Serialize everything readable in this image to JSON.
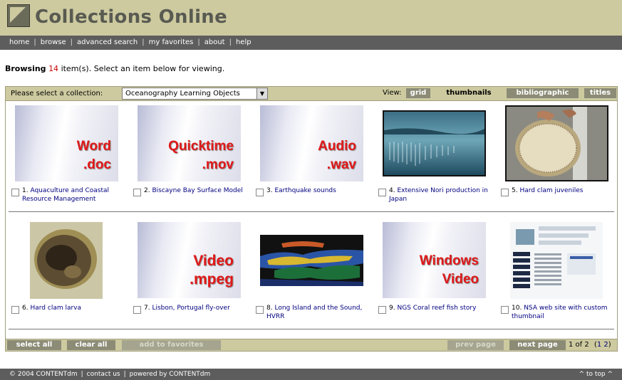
{
  "app": {
    "title": "Collections Online"
  },
  "nav": {
    "items": [
      "home",
      "browse",
      "advanced search",
      "my favorites",
      "about",
      "help"
    ]
  },
  "browse": {
    "prefix": "Browsing",
    "count": "14",
    "suffix": "item(s). Select an item below for viewing."
  },
  "toolbar": {
    "collection_label": "Please select a collection:",
    "collection_value": "Oceanography Learning Objects",
    "view_label": "View:",
    "views": [
      "grid",
      "thumbnails",
      "bibliographic",
      "titles"
    ],
    "active_view": "thumbnails"
  },
  "items": [
    {
      "num": "1.",
      "title": "Aquaculture and Coastal Resource Management",
      "thumb": "placeholder",
      "thumb_text": [
        "Word",
        ".doc"
      ]
    },
    {
      "num": "2.",
      "title": "Biscayne Bay Surface Model",
      "thumb": "placeholder",
      "thumb_text": [
        "Quicktime",
        ".mov"
      ]
    },
    {
      "num": "3.",
      "title": "Earthquake sounds",
      "thumb": "placeholder",
      "thumb_text": [
        "Audio",
        ".wav"
      ]
    },
    {
      "num": "4.",
      "title": "Extensive Nori production in Japan",
      "thumb": "photo-sea"
    },
    {
      "num": "5.",
      "title": "Hard clam juveniles",
      "thumb": "photo-clam-sieve"
    },
    {
      "num": "6.",
      "title": "Hard clam larva",
      "thumb": "photo-larva"
    },
    {
      "num": "7.",
      "title": "Lisbon, Portugal fly-over",
      "thumb": "placeholder",
      "thumb_text": [
        "Video",
        ".mpeg"
      ]
    },
    {
      "num": "8.",
      "title": "Long Island and the Sound, HVRR",
      "thumb": "photo-satellite"
    },
    {
      "num": "9.",
      "title": "NGS Coral reef fish story",
      "thumb": "placeholder",
      "thumb_text": [
        "Windows",
        "Video"
      ]
    },
    {
      "num": "10.",
      "title": "NSA web site with custom thumbnail",
      "thumb": "photo-website"
    }
  ],
  "bottom": {
    "select_all": "select all",
    "clear_all": "clear all",
    "add_favorites": "add to favorites",
    "prev_page": "prev page",
    "next_page": "next page",
    "page_status": "1 of 2",
    "pages_open": "(",
    "page_1": "1",
    "page_2": "2",
    "pages_close": ")"
  },
  "footer": {
    "copyright": "© 2004 CONTENTdm",
    "contact": "contact us",
    "powered": "powered by CONTENTdm",
    "to_top": "^ to top ^"
  },
  "colors": {
    "header_bg": "#cdcaa0",
    "nav_bg": "#5d5d5d",
    "button_bg": "#8b8b76",
    "count_red": "#c80000",
    "link_blue": "#000080"
  }
}
